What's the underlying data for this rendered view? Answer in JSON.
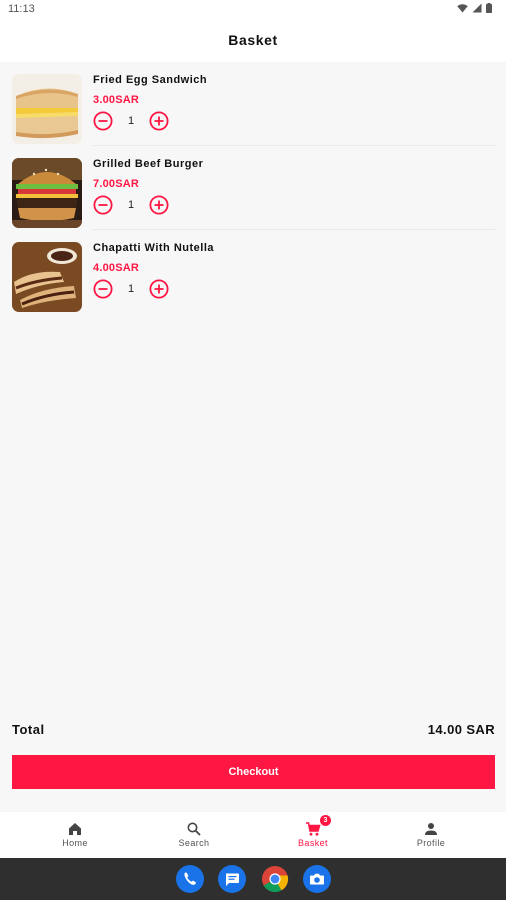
{
  "status_bar": {
    "time": "11:13"
  },
  "app_bar": {
    "title": "Basket"
  },
  "basket": {
    "items": [
      {
        "name": "Fried Egg Sandwich",
        "price": "3.00SAR",
        "quantity": "1",
        "image": "fried-egg-sandwich-image"
      },
      {
        "name": "Grilled Beef Burger",
        "price": "7.00SAR",
        "quantity": "1",
        "image": "grilled-beef-burger-image"
      },
      {
        "name": "Chapatti With Nutella",
        "price": "4.00SAR",
        "quantity": "1",
        "image": "chapatti-nutella-image"
      }
    ],
    "total_label": "Total",
    "total_value": "14.00 SAR",
    "checkout_label": "Checkout"
  },
  "nav": {
    "items": [
      {
        "label": "Home",
        "icon": "home-icon",
        "active": false
      },
      {
        "label": "Search",
        "icon": "search-icon",
        "active": false
      },
      {
        "label": "Basket",
        "icon": "cart-icon",
        "active": true,
        "badge": "3"
      },
      {
        "label": "Profile",
        "icon": "person-icon",
        "active": false
      }
    ]
  },
  "dock": [
    "phone-icon",
    "messages-icon",
    "chrome-icon",
    "camera-icon"
  ],
  "colors": {
    "accent": "#ff1744",
    "background": "#f7f7f7",
    "surface": "#ffffff",
    "system_bar": "#2f2f2f"
  }
}
